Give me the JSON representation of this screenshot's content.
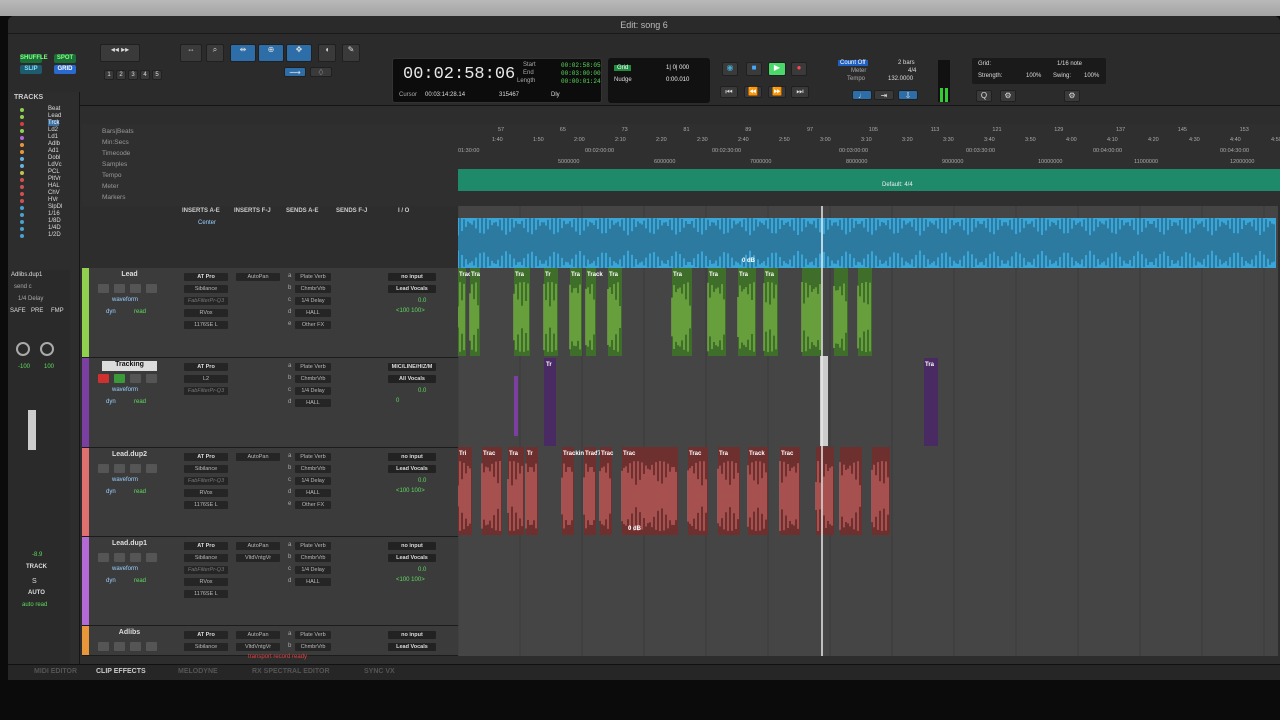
{
  "window_title": "Edit: song 6",
  "edit_modes": [
    "SHUFFLE",
    "SPOT",
    "SLIP",
    "GRID"
  ],
  "zoom_presets": [
    "1",
    "2",
    "3",
    "4",
    "5"
  ],
  "counter": {
    "main": "00:02:58:06",
    "start_label": "Start",
    "end_label": "End",
    "length_label": "Length",
    "start": "00:02:58:05",
    "end": "00:03:00:00",
    "length": "00:00:01:24",
    "cursor_label": "Cursor",
    "cursor": "00:03:14:28.14",
    "samples": "315467",
    "dly": "Dly"
  },
  "grid_nudge": {
    "grid_label": "Grid",
    "grid_value": "1| 0| 000",
    "nudge_label": "Nudge",
    "nudge_value": "0:00.010"
  },
  "meter": {
    "count_off": "Count Off",
    "meter_label": "Meter",
    "tempo_label": "Tempo",
    "bars": "2 bars",
    "meter_value": "4/4",
    "tempo_value": "132.0000"
  },
  "grid_settings": {
    "grid_label": "Grid:",
    "grid_value": "1/16 note",
    "strength_label": "Strength:",
    "strength_value": "100%",
    "swing_label": "Swing:",
    "swing_value": "100%"
  },
  "tracks_list": {
    "header": "TRACKS",
    "items": [
      "Beat",
      "Lead",
      "Trck",
      "Ld2",
      "Ld1",
      "Adlb",
      "Ad1",
      "Dobl",
      "LdVc",
      "PCL",
      "PltVr",
      "HAL",
      "ChV",
      "HVr",
      "SlpDl",
      "1/16",
      "1/8D",
      "1/4D",
      "1/2D"
    ]
  },
  "rulers": [
    "Bars|Beats",
    "Min:Secs",
    "Timecode",
    "Samples",
    "Tempo",
    "Meter",
    "Markers"
  ],
  "bars_ticks": [
    "57",
    "65",
    "73",
    "81",
    "89",
    "97",
    "105",
    "113",
    "121",
    "129",
    "137",
    "145",
    "153"
  ],
  "min_ticks": [
    "1:40",
    "1:50",
    "2:00",
    "2:10",
    "2:20",
    "2:30",
    "2:40",
    "2:50",
    "3:00",
    "3:10",
    "3:20",
    "3:30",
    "3:40",
    "3:50",
    "4:00",
    "4:10",
    "4:20",
    "4:30",
    "4:40",
    "4:50"
  ],
  "tc_ticks": [
    "01:30:00",
    "00:02:00:00",
    "00:02:30:00",
    "00:03:00:00",
    "00:03:30:00",
    "00:04:00:00",
    "00:04:30:00"
  ],
  "sample_ticks": [
    "5000000",
    "6000000",
    "7000000",
    "8000000",
    "9000000",
    "10000000",
    "11000000",
    "12000000"
  ],
  "meter_text": "Default: 4/4",
  "column_headers": [
    "INSERTS A-E",
    "INSERTS F-J",
    "SENDS A-E",
    "SENDS F-J",
    "I / O"
  ],
  "tracks": [
    {
      "name": "Lead",
      "inserts": [
        "AT Pro",
        "Sibilance",
        "FabFilterPr-Q3",
        "RVox",
        "1176SE L"
      ],
      "inserts2": [
        "AutoPan"
      ],
      "sends": [
        "Plate Verb",
        "ChmbrVrb",
        "1/4 Delay",
        "HALL",
        "Other FX"
      ],
      "send_letters": [
        "a",
        "b",
        "c",
        "d",
        "e"
      ],
      "io": [
        "no input",
        "Lead Vocals"
      ],
      "vol": "0.0",
      "pan": "<100 100>",
      "view": "waveform",
      "dyn": "dyn",
      "read": "read"
    },
    {
      "name": "Tracking",
      "inserts": [
        "AT Pro",
        "L2",
        "FabFilterPr-Q3"
      ],
      "inserts2": [],
      "sends": [
        "Plate Verb",
        "ChmbrVrb",
        "1/4 Delay",
        "HALL"
      ],
      "send_letters": [
        "a",
        "b",
        "c",
        "d"
      ],
      "io": [
        "MIC/LINE/HIZ/M",
        "All Vocals"
      ],
      "vol": "0.0",
      "pan": "0",
      "view": "waveform",
      "dyn": "dyn",
      "read": "read"
    },
    {
      "name": "Lead.dup2",
      "inserts": [
        "AT Pro",
        "Sibilance",
        "FabFilterPr-Q3",
        "RVox",
        "1176SE L"
      ],
      "inserts2": [
        "AutoPan"
      ],
      "sends": [
        "Plate Verb",
        "ChmbrVrb",
        "1/4 Delay",
        "HALL",
        "Other FX"
      ],
      "send_letters": [
        "a",
        "b",
        "c",
        "d",
        "e"
      ],
      "io": [
        "no input",
        "Lead Vocals"
      ],
      "vol": "0.0",
      "pan": "<100 100>",
      "view": "waveform",
      "dyn": "dyn",
      "read": "read"
    },
    {
      "name": "Lead.dup1",
      "inserts": [
        "AT Pro",
        "Sibilance",
        "FabFilterPr-Q3",
        "RVox",
        "1176SE L"
      ],
      "inserts2": [
        "AutoPan",
        "VltdVntgVr"
      ],
      "sends": [
        "Plate Verb",
        "ChmbrVrb",
        "1/4 Delay",
        "HALL"
      ],
      "send_letters": [
        "a",
        "b",
        "c",
        "d"
      ],
      "io": [
        "no input",
        "Lead Vocals"
      ],
      "vol": "0.0",
      "pan": "<100 100>",
      "view": "waveform",
      "dyn": "dyn",
      "read": "read"
    },
    {
      "name": "Adlibs",
      "inserts": [
        "AT Pro",
        "Sibilance"
      ],
      "inserts2": [
        "AutoPan",
        "VltdVntgVr"
      ],
      "sends": [
        "Plate Verb",
        "ChmbrVrb"
      ],
      "send_letters": [
        "a",
        "b"
      ],
      "io": [
        "no input",
        "Lead Vocals"
      ],
      "vol": "",
      "pan": "",
      "view": "",
      "dyn": "",
      "read": ""
    }
  ],
  "clip_labels": {
    "top": "0 dB",
    "lead": [
      "Trac",
      "Tra",
      "Tra",
      "Tr",
      "Tra",
      "Track",
      "Tra",
      "Tra",
      "Tra",
      "Tra",
      "Tra"
    ],
    "tracking": [
      "Tr",
      "Tra"
    ],
    "dup2": [
      "Tri",
      "Trac",
      "Tra",
      "Tr",
      "Tracking_277-0",
      "Trac",
      "Trac",
      "Trac",
      "Trac",
      "Tra",
      "Track",
      "Trac"
    ],
    "db": "0 dB"
  },
  "center_label": "Center",
  "channel_strip": {
    "name": "Adlibs.dup1",
    "send": "send c",
    "delay": "1/4 Delay",
    "safe": "SAFE",
    "pre": "PRE",
    "fmp": "FMP",
    "pan_l": "-100",
    "pan_r": "100",
    "level": "-8.9",
    "track_label": "TRACK",
    "s_label": "S",
    "auto_label": "AUTO",
    "auto_mode": "auto read"
  },
  "status_text": "transport record ready",
  "bottom_tabs": [
    "MIDI EDITOR",
    "CLIP EFFECTS",
    "MELODYNE",
    "RX SPECTRAL EDITOR",
    "SYNC VX"
  ],
  "colors": {
    "lead": "#8fd14f",
    "tracking": "#7a3fa0",
    "dup2": "#e07070",
    "dup1": "#b36ad6",
    "adlibs": "#e8963a",
    "top": "#3aa6d8"
  }
}
